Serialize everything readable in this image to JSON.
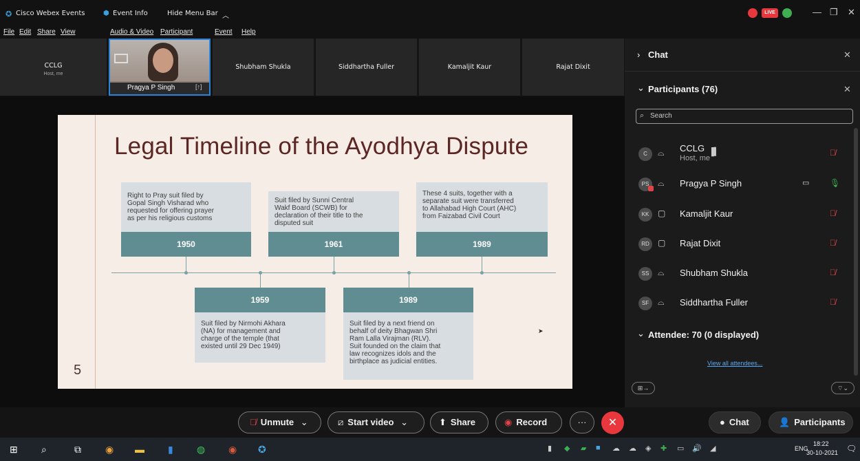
{
  "titlebar": {
    "app_name": "Cisco Webex Events",
    "event_info": "Event Info",
    "hide_menu": "Hide Menu Bar",
    "live_badge": "LIVE"
  },
  "menubar": [
    "File",
    "Edit",
    "Share",
    "View",
    "Audio & Video",
    "Participant",
    "Event",
    "Help"
  ],
  "video_strip": {
    "host_name": "CCLG",
    "host_sub": "Host, me",
    "active_name": "Pragya P Singh",
    "tiles": [
      "Shubham Shukla",
      "Siddhartha Fuller",
      "Kamaljit Kaur",
      "Rajat Dixit"
    ]
  },
  "slide": {
    "title": "Legal Timeline of the Ayodhya Dispute",
    "page_number": "5",
    "top_events": [
      {
        "year": "1950",
        "text": [
          "Right to Pray suit filed by",
          "Gopal Singh Visharad who",
          "requested for offering prayer",
          "as per his religious customs"
        ]
      },
      {
        "year": "1961",
        "text": [
          "Suit filed by Sunni Central",
          "Wakf Board (SCWB) for",
          "declaration of their title to the",
          "disputed suit"
        ]
      },
      {
        "year": "1989",
        "text": [
          "These 4 suits, together with a",
          "separate suit were transferred",
          "to Allahabad High Court (AHC)",
          "from Faizabad Civil Court"
        ]
      }
    ],
    "bottom_events": [
      {
        "year": "1959",
        "text": [
          "Suit filed by Nirmohi Akhara",
          "(NA) for management and",
          "charge of the temple (that",
          "existed until 29 Dec 1949)"
        ]
      },
      {
        "year": "1989",
        "text": [
          "Suit filed by a next friend on",
          "behalf of deity Bhagwan Shri",
          "Ram Lalla Virajman (RLV).",
          "Suit founded on the claim that",
          "law recognizes idols and the",
          "birthplace as judicial entities."
        ]
      }
    ]
  },
  "panel": {
    "chat_header": "Chat",
    "participants_header": "Participants (76)",
    "search_placeholder": "Search",
    "participants": [
      {
        "initials": "C",
        "name": "CCLG",
        "sub": "Host, me"
      },
      {
        "initials": "PS",
        "name": "Pragya P Singh"
      },
      {
        "initials": "KK",
        "name": "Kamaljit Kaur"
      },
      {
        "initials": "RD",
        "name": "Rajat Dixit"
      },
      {
        "initials": "SS",
        "name": "Shubham Shukla"
      },
      {
        "initials": "SF",
        "name": "Siddhartha Fuller"
      }
    ],
    "attendee_header": "Attendee: 70 (0 displayed)",
    "view_all": "View all attendees..."
  },
  "controls": {
    "unmute": "Unmute",
    "start_video": "Start video",
    "share": "Share",
    "record": "Record",
    "more": "···",
    "chat": "Chat",
    "participants": "Participants"
  },
  "taskbar": {
    "lang": "ENG",
    "time": "18:22",
    "date": "30-10-2021"
  },
  "colors": {
    "accent_teal": "#5f8d92",
    "slide_bg": "#f5ede6",
    "title_red": "#5b2623",
    "mute_red": "#e0434a",
    "end_red": "#e8383d",
    "active_border": "#2a82da"
  }
}
